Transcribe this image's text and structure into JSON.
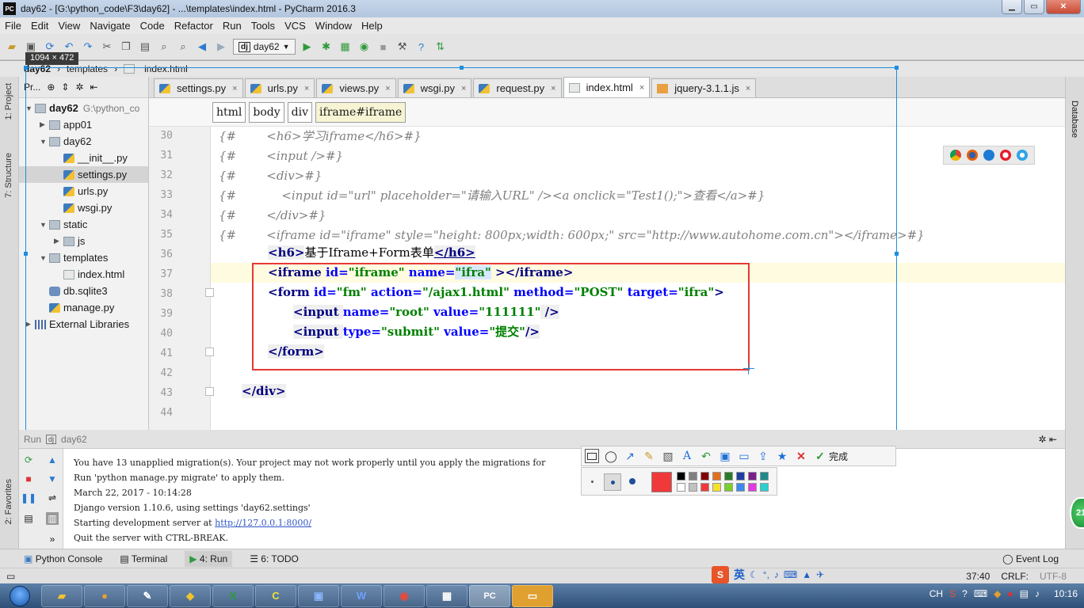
{
  "window": {
    "app_icon_text": "PC",
    "title": "day62 - [G:\\python_code\\F3\\day62] - ...\\templates\\index.html - PyCharm 2016.3"
  },
  "menu": [
    "File",
    "Edit",
    "View",
    "Navigate",
    "Code",
    "Refactor",
    "Run",
    "Tools",
    "VCS",
    "Window",
    "Help"
  ],
  "toolbar": {
    "run_config": "day62"
  },
  "selection_size": "1094 × 472",
  "nav": {
    "project": "day62",
    "folder": "templates",
    "file": "index.html"
  },
  "side_tools": {
    "project": "1: Project",
    "structure": "7: Structure",
    "favorites": "2: Favorites",
    "database": "Database"
  },
  "project_panel": {
    "header": "Pr...",
    "tree": [
      {
        "label": "day62",
        "extra": "G:\\python_co",
        "level": 0,
        "type": "folder",
        "expanded": true
      },
      {
        "label": "app01",
        "level": 1,
        "type": "folder",
        "expanded": false
      },
      {
        "label": "day62",
        "level": 1,
        "type": "folder",
        "expanded": true
      },
      {
        "label": "__init__.py",
        "level": 2,
        "type": "py"
      },
      {
        "label": "settings.py",
        "level": 2,
        "type": "py",
        "selected": true
      },
      {
        "label": "urls.py",
        "level": 2,
        "type": "py"
      },
      {
        "label": "wsgi.py",
        "level": 2,
        "type": "py"
      },
      {
        "label": "static",
        "level": 1,
        "type": "folder",
        "expanded": true
      },
      {
        "label": "js",
        "level": 2,
        "type": "folder",
        "expanded": false
      },
      {
        "label": "templates",
        "level": 1,
        "type": "folder",
        "expanded": true
      },
      {
        "label": "index.html",
        "level": 2,
        "type": "html"
      },
      {
        "label": "db.sqlite3",
        "level": 1,
        "type": "db"
      },
      {
        "label": "manage.py",
        "level": 1,
        "type": "py"
      },
      {
        "label": "External Libraries",
        "level": 0,
        "type": "lib",
        "expanded": false
      }
    ]
  },
  "tabs": [
    {
      "label": "settings.py",
      "active": false
    },
    {
      "label": "urls.py",
      "active": false
    },
    {
      "label": "views.py",
      "active": false
    },
    {
      "label": "wsgi.py",
      "active": false
    },
    {
      "label": "request.py",
      "active": false
    },
    {
      "label": "index.html",
      "active": true
    },
    {
      "label": "jquery-3.1.1.js",
      "active": false
    }
  ],
  "breadcrumbs": [
    "html",
    "body",
    "div",
    "iframe#iframe"
  ],
  "code": {
    "line_numbers": [
      "30",
      "31",
      "32",
      "33",
      "34",
      "35",
      "36",
      "37",
      "38",
      "39",
      "40",
      "41",
      "42",
      "43",
      "44"
    ],
    "l30": "{#        <h6>学习iframe</h6>#}",
    "l31": "{#        <input />#}",
    "l32": "{#        <div>#}",
    "l33": "{#            <input id=\"url\" placeholder=\"请输入URL\" /><a onclick=\"Test1();\">查看</a>#}",
    "l34": "{#        </div>#}",
    "l35": "{#        <iframe id=\"iframe\" style=\"height: 800px;width: 600px;\" src=\"http://www.autohome.com.cn\"></iframe>#}",
    "l36": {
      "open": "<h6>",
      "text": "基于Iframe+Form表单",
      "close": "</h6>"
    },
    "l37": {
      "tag": "<iframe ",
      "a1": "id=",
      "v1": "\"iframe\"",
      "a2": " name=",
      "v2": "\"ifra\"",
      "end": " ></iframe>"
    },
    "l38": {
      "tag": "<form ",
      "a1": "id=",
      "v1": "\"fm\"",
      "a2": " action=",
      "v2": "\"/ajax1.html\"",
      "a3": " method=",
      "v3": "\"POST\"",
      "a4": " target=",
      "v4": "\"ifra\"",
      "end": ">"
    },
    "l39": {
      "tag": "<input ",
      "a1": "name=",
      "v1": "\"root\"",
      "a2": " value=",
      "v2": "\"111111\"",
      "end": " />"
    },
    "l40": {
      "tag": "<input ",
      "a1": "type=",
      "v1": "\"submit\"",
      "a2": " value=",
      "v2": "\"提交\"",
      "end": "/>"
    },
    "l41": "</form>",
    "l43": "</div>"
  },
  "run_panel": {
    "label": "Run",
    "config": "day62"
  },
  "console": [
    "You have 13 unapplied migration(s). Your project may not work properly until you apply the migrations for",
    "Run 'python manage.py migrate' to apply them.",
    "March 22, 2017 - 10:14:28",
    "Django version 1.10.6, using settings 'day62.settings'"
  ],
  "console_server_prefix": "Starting development server at ",
  "console_server_url": "http://127.0.0.1:8000/",
  "console_quit": "Quit the server with CTRL-BREAK.",
  "bottom_tabs": {
    "python_console": "Python Console",
    "terminal": "Terminal",
    "run": "4: Run",
    "todo": "6: TODO",
    "event_log": "Event Log"
  },
  "status": {
    "position": "37:40",
    "line_sep": "CRLF:",
    "encoding": "UTF-8"
  },
  "screenshot_tool": {
    "done_label": "完成",
    "selected_color": "#f03a3a"
  },
  "ime_label": "英",
  "taskbar": {
    "clock": "10:16",
    "lang": "CH",
    "active_label": "PC"
  },
  "badge_number": "21"
}
